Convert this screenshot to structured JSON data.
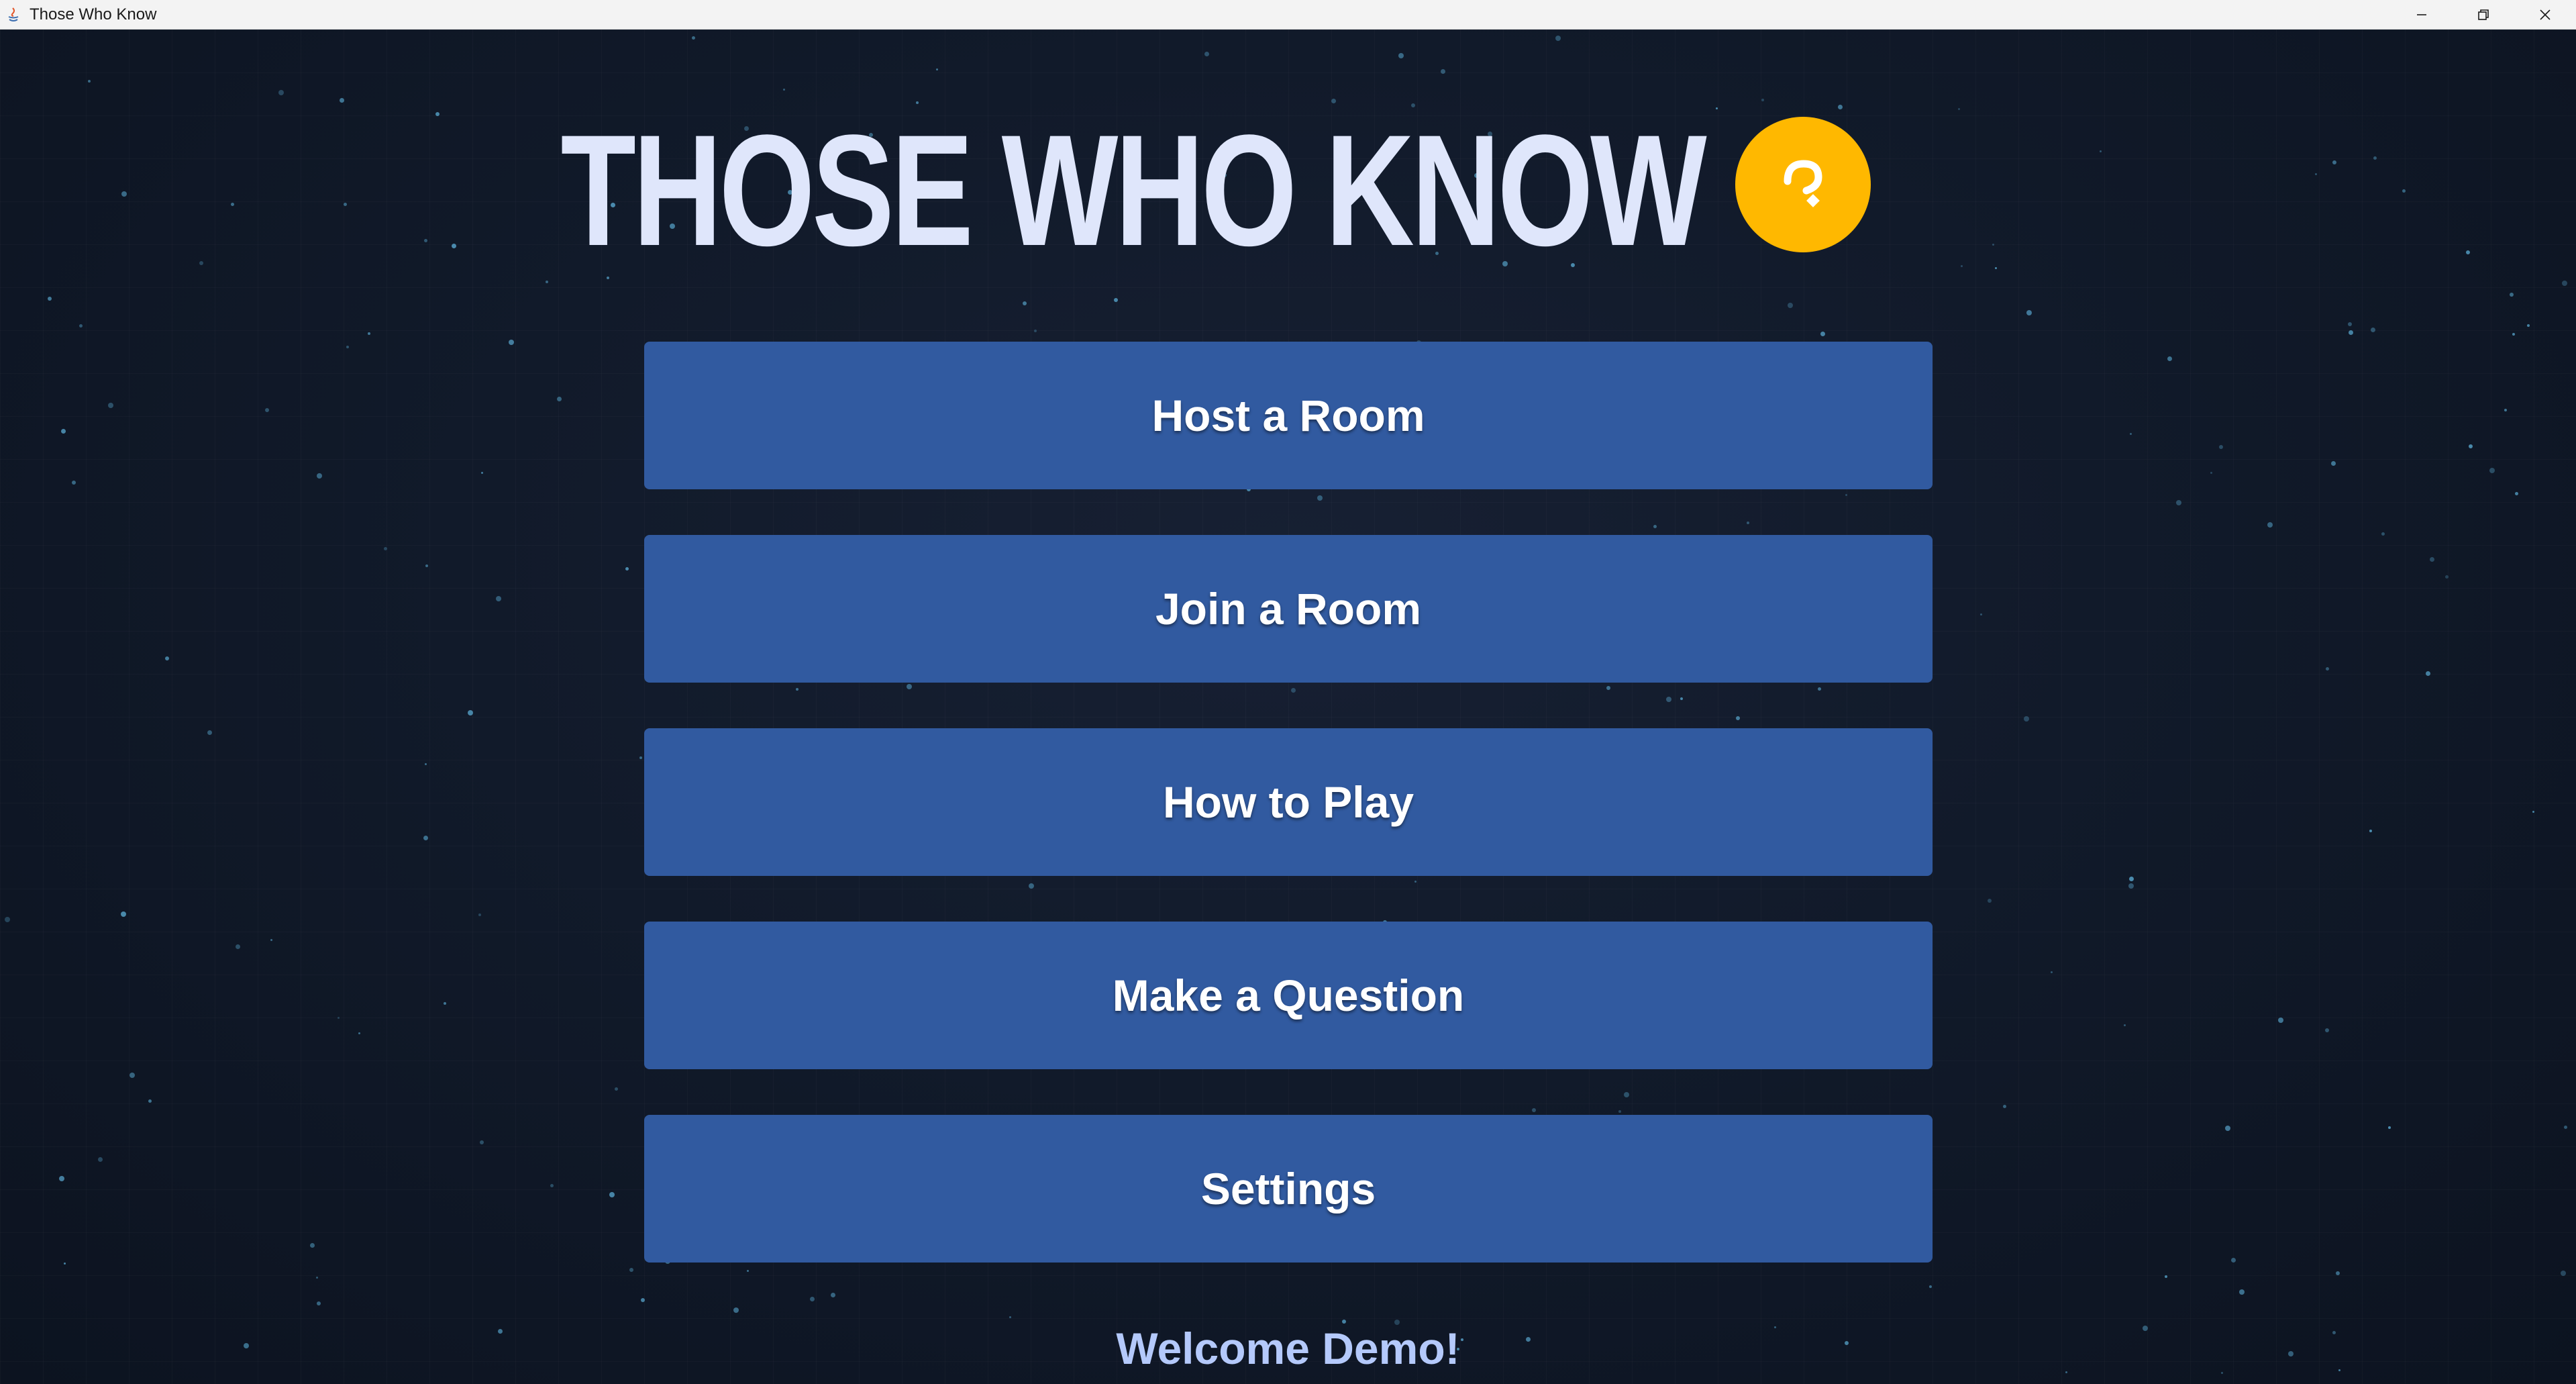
{
  "window": {
    "title": "Those Who Know",
    "controls": [
      "minimize-icon",
      "restore-icon",
      "close-icon"
    ]
  },
  "logo": {
    "text": "THOSE WHO KNOW",
    "badge_icon": "question-mark-icon",
    "badge_color": "#ffb800",
    "text_color": "#dfe6fb"
  },
  "menu": {
    "host_room": "Host a Room",
    "join_room": "Join a Room",
    "how_to_play": "How to Play",
    "make_question": "Make a Question",
    "settings": "Settings",
    "button_color": "#315aa0"
  },
  "footer": {
    "welcome": "Welcome Demo!",
    "welcome_color": "#b4c9fb"
  },
  "colors": {
    "background": "#0f1726",
    "star": "#4f94b8"
  }
}
